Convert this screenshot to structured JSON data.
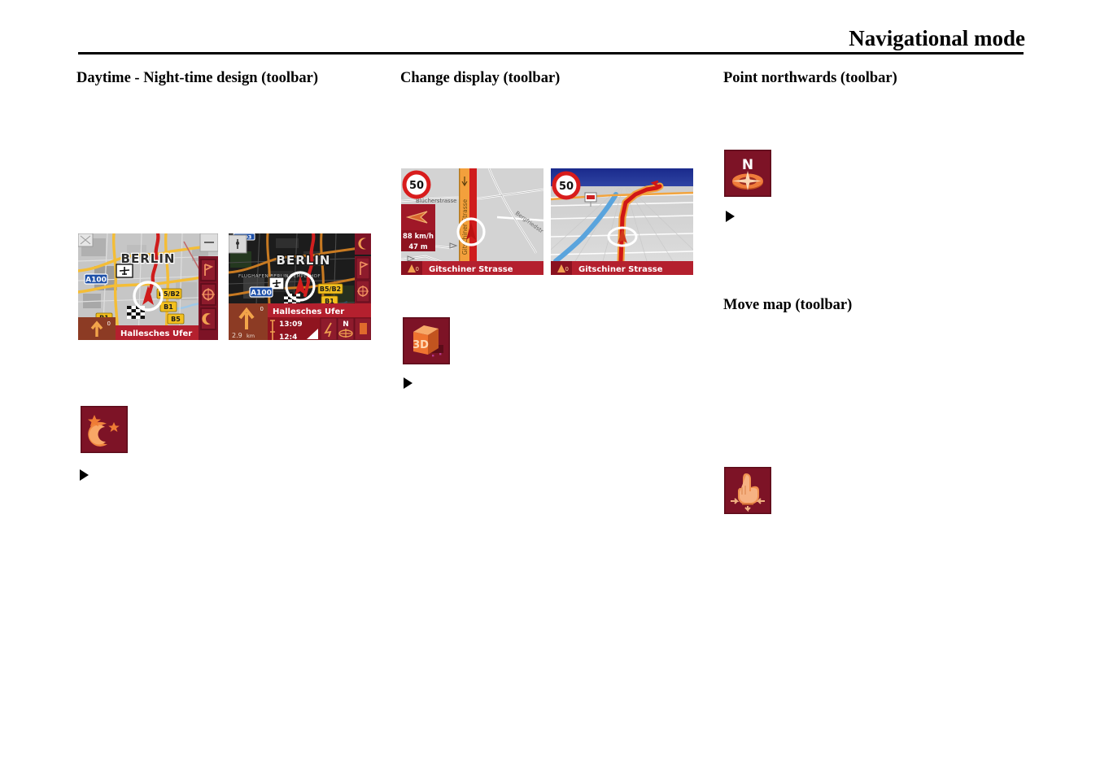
{
  "header": {
    "title": "Navigational mode"
  },
  "sections": [
    {
      "id": "daytime",
      "heading": "Daytime - Night-time design (toolbar)"
    },
    {
      "id": "change",
      "heading": "Change display (toolbar)"
    },
    {
      "id": "north",
      "heading": "Point northwards (toolbar)"
    },
    {
      "id": "move",
      "heading": "Move map (toolbar)"
    }
  ],
  "icons": {
    "night": {
      "name": "moon-stars-icon",
      "label": "Daytime - Night-time design",
      "bg": "#7d1326",
      "fg": "#f08a4a"
    },
    "three_d": {
      "name": "3d-cube-icon",
      "label": "Change display",
      "bg": "#7d1326",
      "fg": "#f0763a",
      "text": "3D"
    },
    "north": {
      "name": "compass-north-icon",
      "label": "Point northwards",
      "bg": "#7d1326",
      "fg": "#ef7c3c",
      "text": "N"
    },
    "move": {
      "name": "pointing-hand-icon",
      "label": "Move map",
      "bg": "#7d1326",
      "fg": "#f0874a"
    }
  },
  "screenshots": {
    "daytime_map": {
      "caption_street": "Hallesches Ufer",
      "city_label": "BERLIN",
      "road_shields": [
        "A100",
        "B5/B2",
        "B1",
        "B5",
        "B1"
      ],
      "distance": "0",
      "mode": "daytime",
      "bg": "#c9c9c9"
    },
    "nighttime_map": {
      "caption_street": "Hallesches Ufer",
      "city_label": "BERLIN",
      "place_label": "FLUGHAFEN BERLIN-TEMPELHOF",
      "road_shields": [
        "A100",
        "B5/B2",
        "B1"
      ],
      "distance": "2.9 km",
      "times": [
        "13:09",
        "12:4"
      ],
      "mode": "nighttime",
      "bg": "#1b1b1b"
    },
    "map_2d": {
      "caption_street": "Gitschiner Strasse",
      "speed_limit": "50",
      "speed": "88 km/h",
      "altitude": "47 m",
      "street_labels": [
        "Blücherstrasse",
        "Bergfriedstr"
      ],
      "mode": "2d"
    },
    "map_3d": {
      "caption_street": "Gitschiner Strasse",
      "speed_limit": "50",
      "mode": "3d"
    }
  },
  "colors": {
    "toolbar_red": "#7d1326",
    "bar_red": "#b4202e",
    "accent_orange": "#f08040",
    "route_red": "#cc1b1b",
    "road_yellow": "#f2c12e",
    "shield_blue": "#1d4fa8"
  }
}
